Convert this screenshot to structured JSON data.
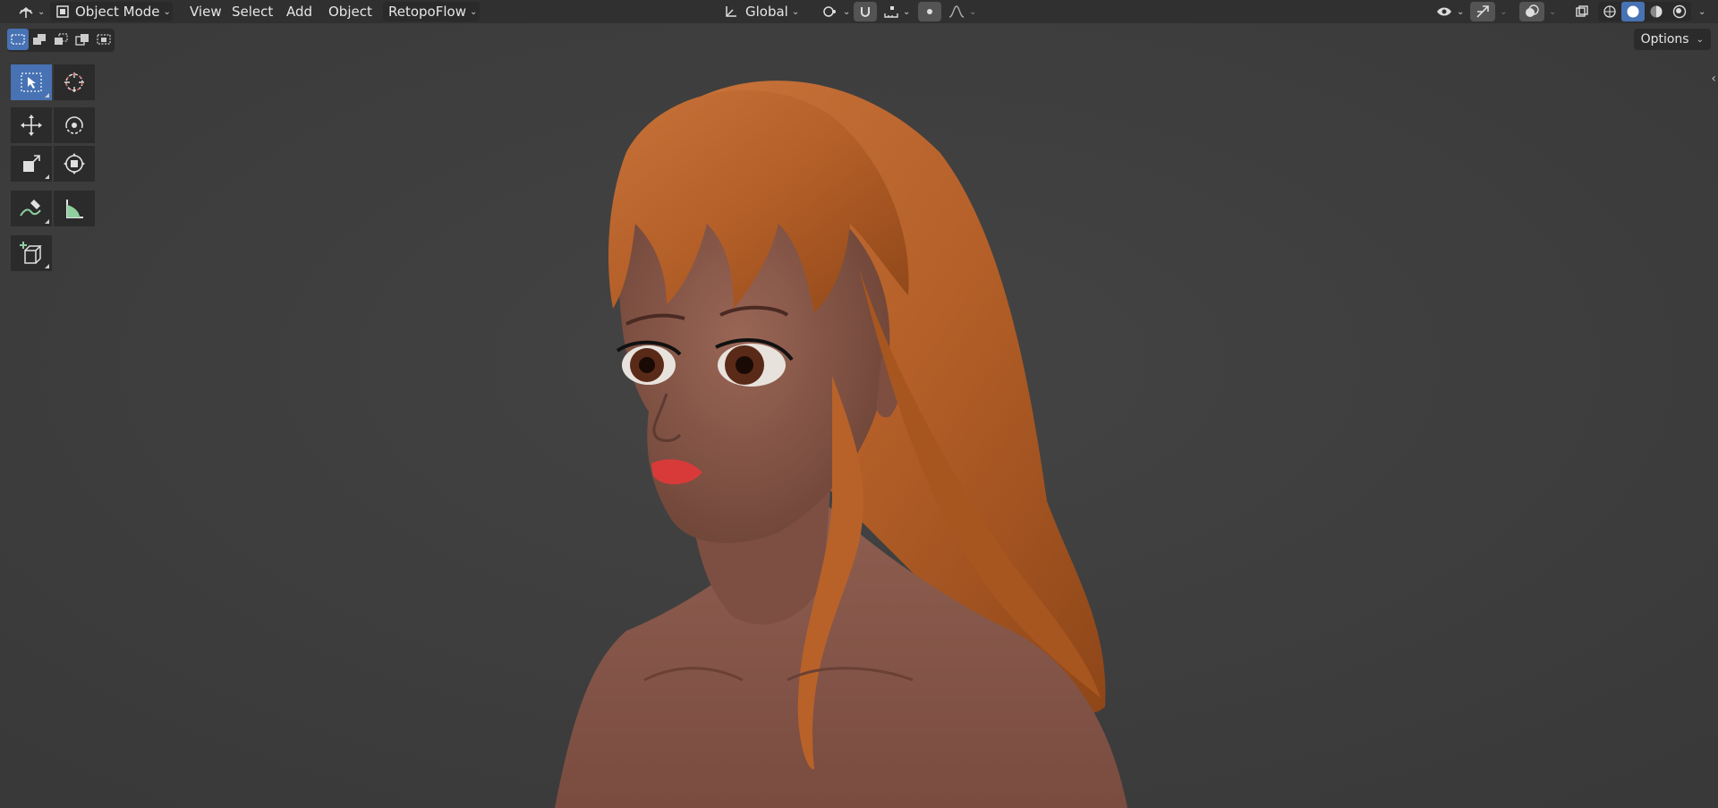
{
  "header": {
    "editor_type_icon": "editor-type-icon",
    "mode": "Object Mode",
    "menus": [
      "View",
      "Select",
      "Add",
      "Object"
    ],
    "addon_menu": "RetopoFlow",
    "orientation": "Global",
    "right_icons": [
      "visibility-icon",
      "gizmo-icon",
      "overlay-icon",
      "xray-icon",
      "wireframe-shading-icon",
      "solid-shading-icon",
      "material-shading-icon",
      "rendered-shading-icon"
    ]
  },
  "select_modes": [
    "select-box-new-icon",
    "select-extend-icon",
    "select-subtract-icon",
    "select-invert-icon",
    "select-intersect-icon"
  ],
  "options_label": "Options",
  "toolbar": {
    "tools": [
      "select-box-tool",
      "cursor-tool",
      "move-tool",
      "rotate-tool",
      "scale-tool",
      "transform-tool",
      "annotate-tool",
      "measure-tool",
      "add-cube-tool"
    ],
    "active": "select-box-tool"
  },
  "colors": {
    "accent": "#4772b3",
    "header_bg": "#303030",
    "viewport_bg": "#3e3e3e",
    "hair": "#b8652c",
    "skin": "#8a5a4c",
    "lips": "#d83a3a"
  }
}
